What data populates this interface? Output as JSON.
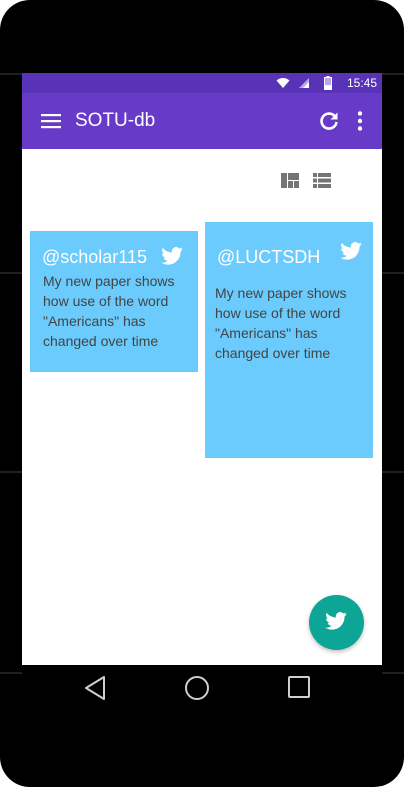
{
  "status_bar": {
    "time": "15:45",
    "icons": [
      "wifi-icon",
      "cell-signal-icon",
      "battery-icon"
    ],
    "background": "#5833b8"
  },
  "app_bar": {
    "title": "SOTU-db",
    "background": "#673ac8",
    "icons": [
      "menu-icon",
      "refresh-icon",
      "more-vert-icon"
    ]
  },
  "view_toggles": [
    "dashboard-view-icon",
    "list-view-icon"
  ],
  "cards": [
    {
      "handle": "@scholar115",
      "text": "My new paper shows how use of the word \"Americans\" has changed over time",
      "icon": "twitter-icon"
    },
    {
      "handle": "@LUCTSDH",
      "text": "My new paper shows how use of the word \"Americans\" has changed over time",
      "icon": "twitter-icon"
    }
  ],
  "card_color": "#6bcbfc",
  "fab": {
    "icon": "twitter-icon",
    "color": "#0da696"
  },
  "nav_bar": {
    "buttons": [
      "back-icon",
      "home-icon",
      "recents-icon"
    ]
  }
}
